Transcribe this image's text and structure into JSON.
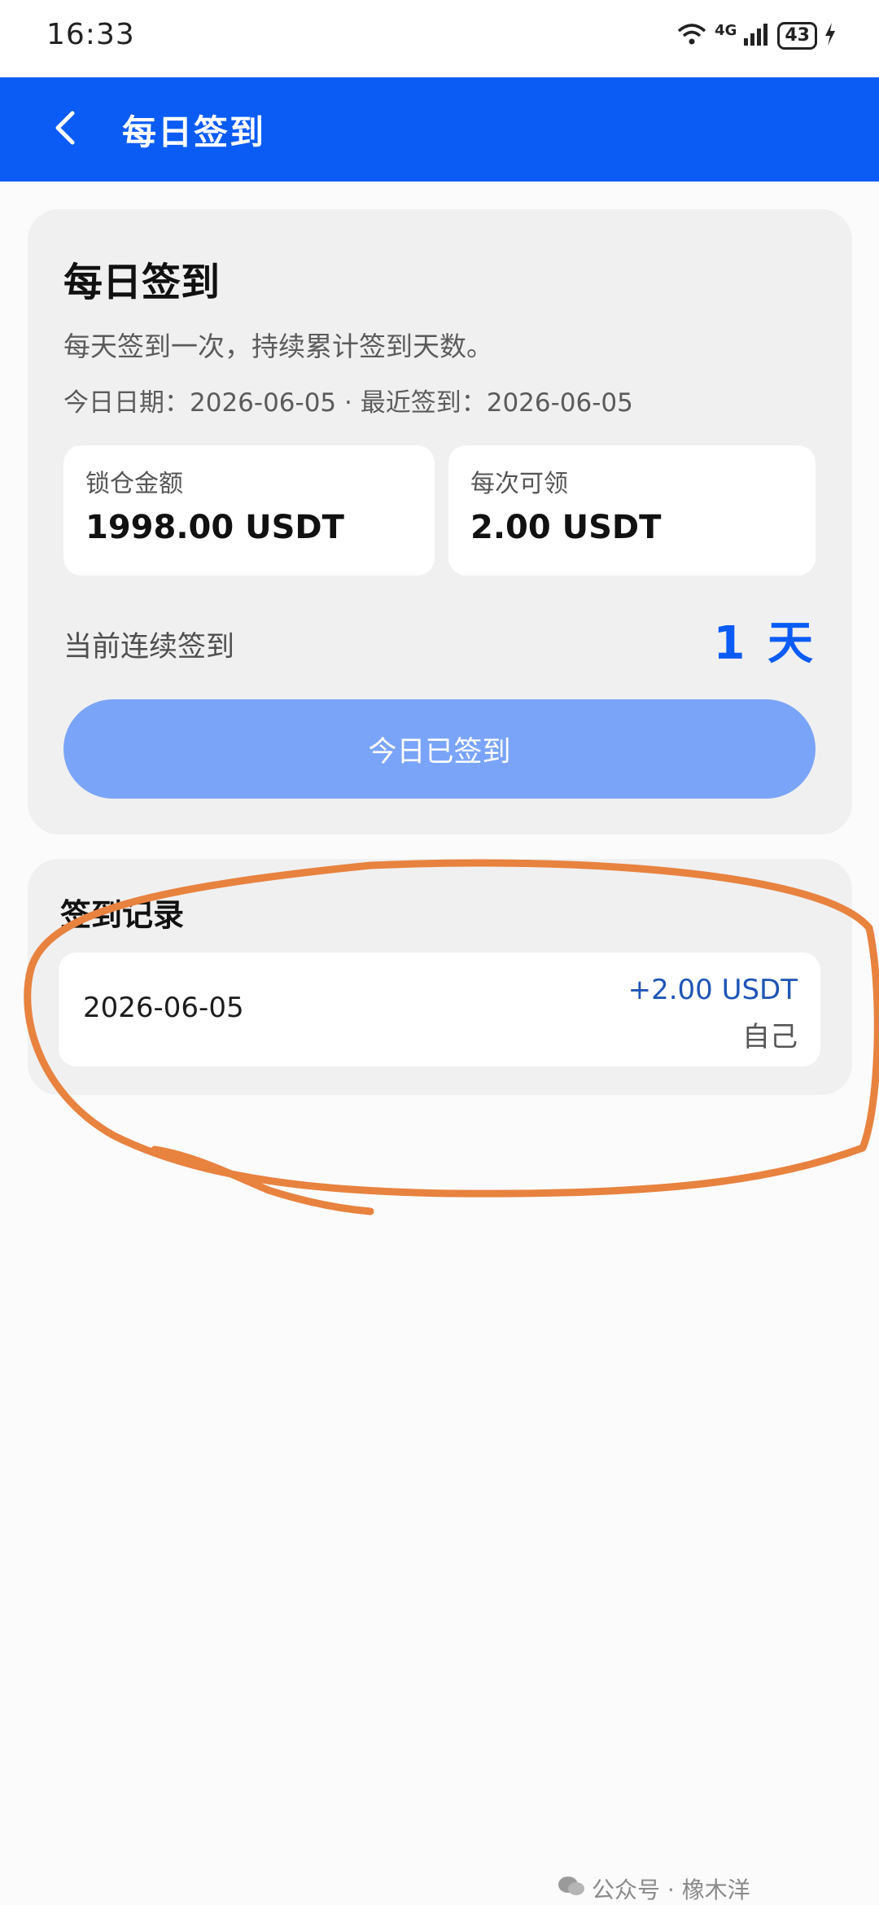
{
  "status_bar": {
    "time": "16:33",
    "network": "4G",
    "battery": "43"
  },
  "header": {
    "title": "每日签到"
  },
  "checkin_card": {
    "title": "每日签到",
    "description": "每天签到一次，持续累计签到天数。",
    "dates_line": "今日日期：2026-06-05 · 最近签到：2026-06-05",
    "stats": [
      {
        "label": "锁仓金额",
        "value": "1998.00 USDT"
      },
      {
        "label": "每次可领",
        "value": "2.00 USDT"
      }
    ],
    "streak_label": "当前连续签到",
    "streak_value": "1 天",
    "button_label": "今日已签到"
  },
  "records": {
    "title": "签到记录",
    "items": [
      {
        "date": "2026-06-05",
        "amount": "+2.00 USDT",
        "source": "自己"
      }
    ]
  },
  "watermark": "公众号 · 橡木洋"
}
